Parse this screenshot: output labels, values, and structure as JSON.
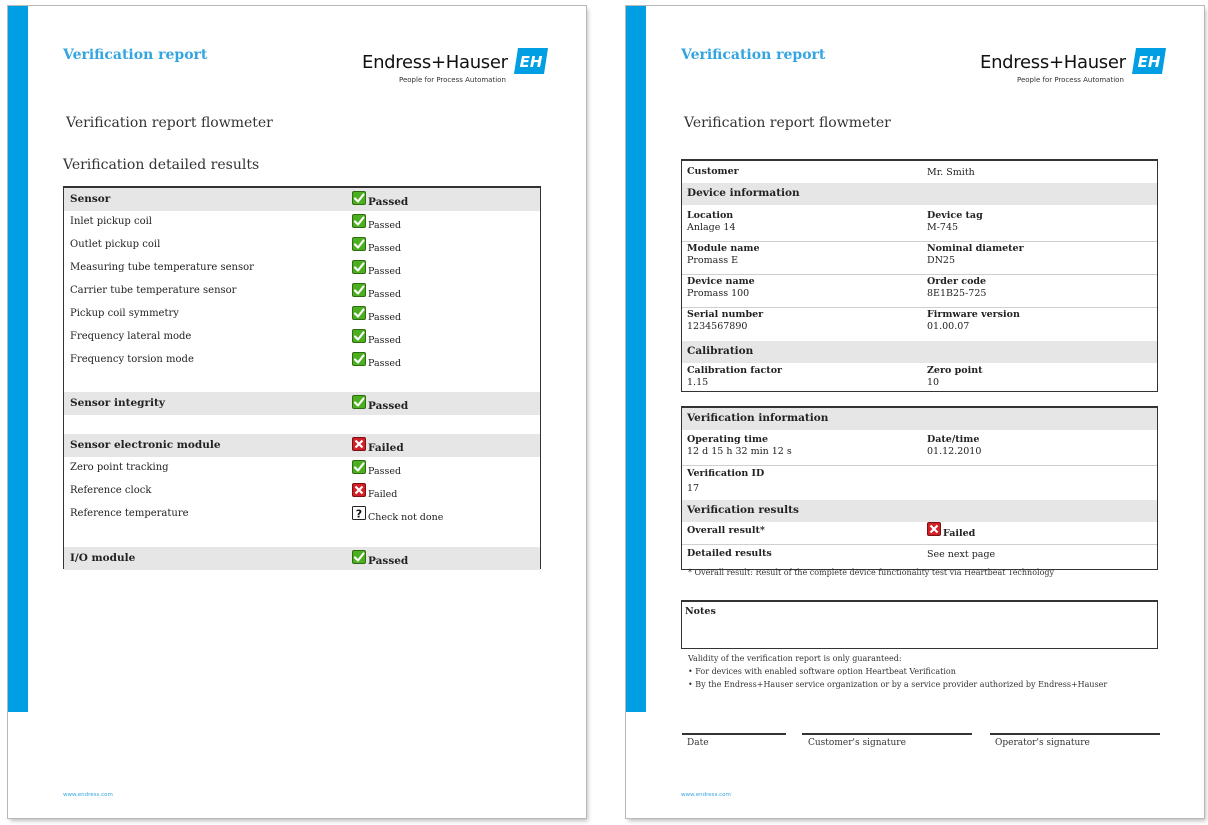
{
  "colors": {
    "accent": "#009fe3",
    "header_text": "#35a5e0",
    "pass": "#4caf1f",
    "fail": "#d32027"
  },
  "header": {
    "title": "Verification report",
    "brand": "Endress+Hauser",
    "tagline": "People for Process Automation",
    "logo_mark": "EH"
  },
  "footer_url": "www.endress.com",
  "left": {
    "doc_title": "Verification report flowmeter",
    "section_title": "Verification detailed results",
    "rows": [
      {
        "label": "Sensor",
        "status": "Passed",
        "icon": "check-icon",
        "head": true
      },
      {
        "label": "Inlet pickup coil",
        "status": "Passed",
        "icon": "check-icon"
      },
      {
        "label": "Outlet pickup coil",
        "status": "Passed",
        "icon": "check-icon"
      },
      {
        "label": "Measuring tube temperature sensor",
        "status": "Passed",
        "icon": "check-icon"
      },
      {
        "label": "Carrier tube temperature sensor",
        "status": "Passed",
        "icon": "check-icon"
      },
      {
        "label": "Pickup coil symmetry",
        "status": "Passed",
        "icon": "check-icon"
      },
      {
        "label": "Frequency lateral mode",
        "status": "Passed",
        "icon": "check-icon"
      },
      {
        "label": "Frequency torsion mode",
        "status": "Passed",
        "icon": "check-icon"
      },
      {
        "label": "Sensor integrity",
        "status": "Passed",
        "icon": "check-icon",
        "head": true
      },
      {
        "label": "Sensor electronic module",
        "status": "Failed",
        "icon": "cross-icon",
        "head": true
      },
      {
        "label": "Zero point tracking",
        "status": "Passed",
        "icon": "check-icon"
      },
      {
        "label": "Reference clock",
        "status": "Failed",
        "icon": "cross-icon"
      },
      {
        "label": "Reference temperature",
        "status": "Check not done",
        "icon": "question-icon"
      },
      {
        "label": "I/O module",
        "status": "Passed",
        "icon": "check-icon",
        "head": true
      }
    ]
  },
  "right": {
    "doc_title": "Verification report flowmeter",
    "customer_label": "Customer",
    "customer_value": "Mr. Smith",
    "device_info_label": "Device information",
    "device_fields": [
      {
        "k": "Location",
        "v": "Anlage 14"
      },
      {
        "k": "Device tag",
        "v": "M-745"
      },
      {
        "k": "Module name",
        "v": "Promass E"
      },
      {
        "k": "Nominal diameter",
        "v": "DN25"
      },
      {
        "k": "Device name",
        "v": "Promass 100"
      },
      {
        "k": "Order code",
        "v": "8E1B25-725"
      },
      {
        "k": "Serial number",
        "v": "1234567890"
      },
      {
        "k": "Firmware version",
        "v": "01.00.07"
      }
    ],
    "calibration_label": "Calibration",
    "calibration_fields": [
      {
        "k": "Calibration factor",
        "v": "1.15"
      },
      {
        "k": "Zero point",
        "v": "10"
      }
    ],
    "verification_info_label": "Verification information",
    "verification_fields": [
      {
        "k": "Operating time",
        "v": "12 d 15 h 32 min 12 s"
      },
      {
        "k": "Date/time",
        "v": "01.12.2010"
      },
      {
        "k": "Verification ID",
        "v": "17"
      }
    ],
    "verification_results_label": "Verification results",
    "overall_label": "Overall result*",
    "overall_value": "Failed",
    "detailed_label": "Detailed results",
    "detailed_value": "See next page",
    "footnote": "* Overall result: Result of the complete device functionality test via Heartbeat Technology",
    "notes_label": "Notes",
    "validity_intro": "Validity of the verification report is only guaranteed:",
    "validity_items": [
      "For devices with enabled software option Heartbeat Verification",
      "By the Endress+Hauser service organization or by a service provider authorized by Endress+Hauser"
    ],
    "sig_date": "Date",
    "sig_customer": "Customer's signature",
    "sig_operator": "Operator's signature"
  }
}
